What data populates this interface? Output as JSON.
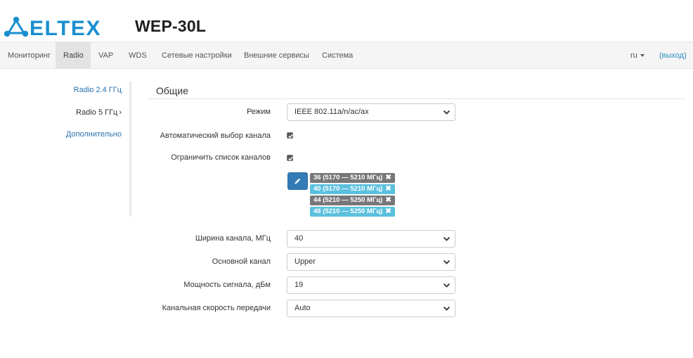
{
  "header": {
    "brand": "ELTEX",
    "model": "WEP-30L"
  },
  "nav": {
    "items": [
      {
        "label": "Мониторинг",
        "active": false
      },
      {
        "label": "Radio",
        "active": true
      },
      {
        "label": "VAP",
        "active": false
      },
      {
        "label": "WDS",
        "active": false
      },
      {
        "label": "Сетевые настройки",
        "active": false
      },
      {
        "label": "Внешние сервисы",
        "active": false
      },
      {
        "label": "Система",
        "active": false
      }
    ],
    "language": "ru",
    "logout": "(выход)"
  },
  "sidebar": {
    "items": [
      {
        "label": "Radio 2.4 ГГц",
        "current": false
      },
      {
        "label": "Radio 5 ГГц",
        "current": true
      },
      {
        "label": "Дополнительно",
        "current": false
      }
    ]
  },
  "section": {
    "title": "Общие"
  },
  "form": {
    "mode": {
      "label": "Режим",
      "value": "IEEE 802.11a/n/ac/ax"
    },
    "auto_channel": {
      "label": "Автоматический выбор канала",
      "checked": true
    },
    "limit_channels": {
      "label": "Ограничить список каналов",
      "checked": true
    },
    "channels": [
      {
        "label": "36 (5170 — 5210 МГц)",
        "color": "#777777"
      },
      {
        "label": "40 (5170 — 5210 МГц)",
        "color": "#5bc0de"
      },
      {
        "label": "44 (5210 — 5250 МГц)",
        "color": "#777777"
      },
      {
        "label": "48 (5210 — 5250 МГц)",
        "color": "#5bc0de"
      }
    ],
    "channel_width": {
      "label": "Ширина канала, МГц",
      "value": "40"
    },
    "primary_channel": {
      "label": "Основной канал",
      "value": "Upper"
    },
    "tx_power": {
      "label": "Мощность сигнала, дБм",
      "value": "19"
    },
    "tx_rate": {
      "label": "Канальная скорость передачи",
      "value": "Auto"
    }
  },
  "colors": {
    "brand": "#1a8fd0",
    "link": "#2a72b0",
    "primary_button": "#337ab7",
    "chip_gray": "#777777",
    "chip_info": "#5bc0de"
  },
  "icons": {
    "edit": "pencil-icon",
    "remove": "remove-icon",
    "select_arrow": "chevron-down-icon",
    "check": "check-icon",
    "submenu": "chevron-right-icon"
  }
}
